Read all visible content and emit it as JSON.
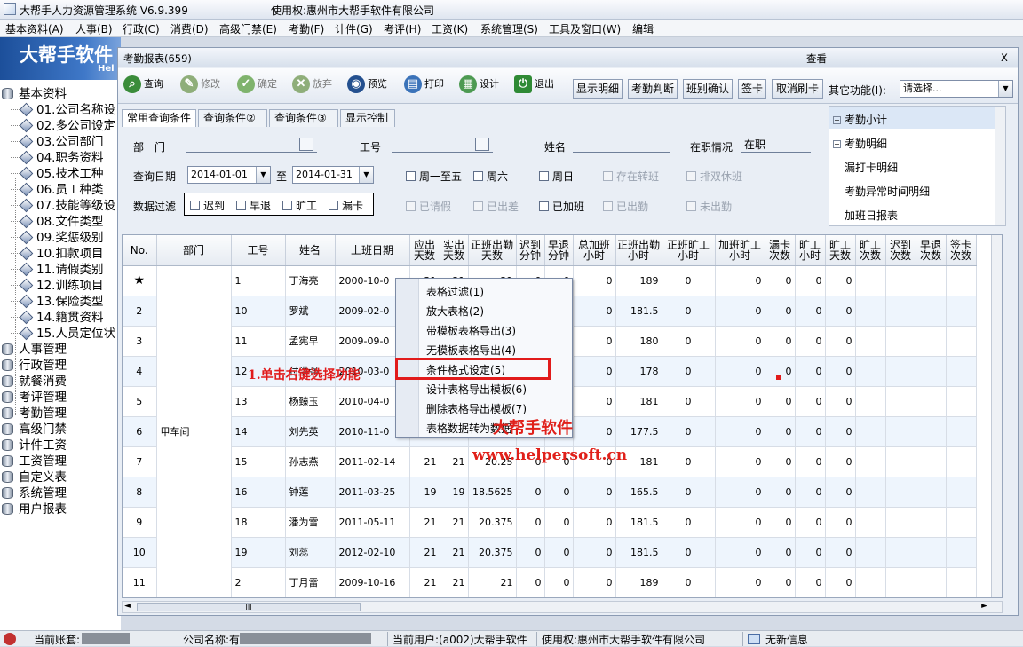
{
  "window": {
    "title": "大帮手人力资源管理系统 V6.9.399",
    "license": "使用权:惠州市大帮手软件有限公司"
  },
  "menu": [
    "基本资料(A)",
    "人事(B)",
    "行政(C)",
    "消费(D)",
    "高级门禁(E)",
    "考勤(F)",
    "计件(G)",
    "考评(H)",
    "工资(K)",
    "系统管理(S)",
    "工具及窗口(W)",
    "编辑"
  ],
  "banner": {
    "text": "大帮手软件",
    "sub": "Hel"
  },
  "tree": {
    "root": "基本资料",
    "children": [
      "01.公司名称设",
      "02.多公司设定",
      "03.公司部门",
      "04.职务资料",
      "05.技术工种",
      "06.员工种类",
      "07.技能等级设",
      "08.文件类型",
      "09.奖惩级别",
      "10.扣款项目",
      "11.请假类别",
      "12.训练项目",
      "13.保险类型",
      "14.籍贯资料",
      "15.人员定位状"
    ],
    "groups": [
      "人事管理",
      "行政管理",
      "就餐消费",
      "考评管理",
      "考勤管理",
      "高级门禁",
      "计件工资",
      "工资管理",
      "自定义表",
      "系统管理",
      "用户报表"
    ]
  },
  "report": {
    "title": "考勤报表(659)",
    "view": "查看",
    "close": "X",
    "toolbar": {
      "query": "查询",
      "edit": "修改",
      "confirm": "确定",
      "abandon": "放弃",
      "preview": "预览",
      "print": "打印",
      "design": "设计",
      "exit": "退出"
    },
    "buttons": {
      "show_detail": "显示明细",
      "judge": "考勤判断",
      "shift_confirm": "班别确认",
      "sign": "签卡",
      "cancel_sign": "取消刷卡",
      "other": "其它功能(I):",
      "other_value": "请选择..."
    },
    "tabs": [
      "常用查询条件",
      "查询条件②",
      "查询条件③",
      "显示控制"
    ],
    "filter": {
      "dept_label": "部　门",
      "empno_label": "工号",
      "name_label": "姓名",
      "status_label": "在职情况",
      "status_value": "在职",
      "date_label": "查询日期",
      "date_from": "2014-01-01",
      "to": "至",
      "date_to": "2014-01-31",
      "weekday": "周一至五",
      "sat": "周六",
      "sun": "周日",
      "transfer": "存在转班",
      "double_rest": "排双休班",
      "data_filter": "数据过滤",
      "late": "迟到",
      "early": "早退",
      "absent": "旷工",
      "miss": "漏卡",
      "leave": "已请假",
      "trip": "已出差",
      "overtime": "已加班",
      "out": "已出勤",
      "not_out": "未出勤"
    },
    "right_panel": [
      "考勤小计",
      "考勤明细",
      "漏打卡明细",
      "考勤异常时间明细",
      "加班日报表"
    ],
    "columns": [
      "No.",
      "部门",
      "工号",
      "姓名",
      "上班日期",
      "应出天数",
      "实出天数",
      "正班出勤天数",
      "迟到分钟",
      "早退分钟",
      "总加班小时",
      "正班出勤小时",
      "正班旷工小时",
      "加班旷工小时",
      "漏卡次数",
      "旷工小时",
      "旷工天数",
      "旷工次数",
      "迟到次数",
      "早退次数",
      "签卡次数"
    ],
    "dept": "甲车间",
    "rows": [
      [
        "★",
        "",
        "1",
        "丁海亮",
        "2000-10-0",
        "21",
        "21",
        "21",
        "0",
        "0",
        "0",
        "189",
        "0",
        "0",
        "0",
        "0",
        "0",
        "",
        "",
        "",
        ""
      ],
      [
        "2",
        "",
        "10",
        "罗斌",
        "2009-02-0",
        "",
        "",
        "",
        "",
        "0",
        "0",
        "181.5",
        "0",
        "0",
        "0",
        "0",
        "0",
        "",
        "",
        "",
        ""
      ],
      [
        "3",
        "",
        "11",
        "孟宪早",
        "2009-09-0",
        "",
        "",
        "",
        "",
        "0",
        "0",
        "180",
        "0",
        "0",
        "0",
        "0",
        "0",
        "",
        "",
        "",
        ""
      ],
      [
        "4",
        "",
        "12",
        "付洪强",
        "2010-03-0",
        "",
        "",
        "",
        "",
        "0",
        "0",
        "178",
        "0",
        "0",
        "0",
        "0",
        "0",
        "",
        "",
        "",
        ""
      ],
      [
        "5",
        "",
        "13",
        "杨臻玉",
        "2010-04-0",
        "",
        "",
        "",
        "",
        "0",
        "0",
        "181",
        "0",
        "0",
        "0",
        "0",
        "0",
        "",
        "",
        "",
        ""
      ],
      [
        "6",
        "",
        "14",
        "刘先英",
        "2010-11-0",
        "",
        "",
        "",
        "",
        "0",
        "0",
        "177.5",
        "0",
        "0",
        "0",
        "0",
        "0",
        "",
        "",
        "",
        ""
      ],
      [
        "7",
        "",
        "15",
        "孙志燕",
        "2011-02-14",
        "21",
        "21",
        "20.25",
        "0",
        "0",
        "0",
        "181",
        "0",
        "0",
        "0",
        "0",
        "0",
        "",
        "",
        "",
        ""
      ],
      [
        "8",
        "",
        "16",
        "钟莲",
        "2011-03-25",
        "19",
        "19",
        "18.5625",
        "0",
        "0",
        "0",
        "165.5",
        "0",
        "0",
        "0",
        "0",
        "0",
        "",
        "",
        "",
        ""
      ],
      [
        "9",
        "",
        "18",
        "潘为雪",
        "2011-05-11",
        "21",
        "21",
        "20.375",
        "0",
        "0",
        "0",
        "181.5",
        "0",
        "0",
        "0",
        "0",
        "0",
        "",
        "",
        "",
        ""
      ],
      [
        "10",
        "",
        "19",
        "刘蕊",
        "2012-02-10",
        "21",
        "21",
        "20.375",
        "0",
        "0",
        "0",
        "181.5",
        "0",
        "0",
        "0",
        "0",
        "0",
        "",
        "",
        "",
        ""
      ],
      [
        "11",
        "",
        "2",
        "丁月雷",
        "2009-10-16",
        "21",
        "21",
        "21",
        "0",
        "0",
        "0",
        "189",
        "0",
        "0",
        "0",
        "0",
        "0",
        "",
        "",
        "",
        ""
      ]
    ],
    "context_menu": [
      "表格过滤(1)",
      "放大表格(2)",
      "带模板表格导出(3)",
      "无模板表格导出(4)",
      "条件格式设定(5)",
      "设计表格导出模板(6)",
      "删除表格导出模板(7)",
      "表格数据转为数据"
    ],
    "annotation": "1.单击右键选择功能",
    "watermark": {
      "name": "大帮手软件",
      "url": "www.helpersoft.cn"
    },
    "hscroll_label": "III"
  },
  "status": {
    "account": "当前账套:",
    "company": "公司名称:有",
    "user": "当前用户:(a002)大帮手软件",
    "license": "使用权:惠州市大帮手软件有限公司",
    "msg": "无新信息"
  },
  "colors": {
    "accent": "#1c4f9a",
    "highlight": "#e11b1b"
  }
}
